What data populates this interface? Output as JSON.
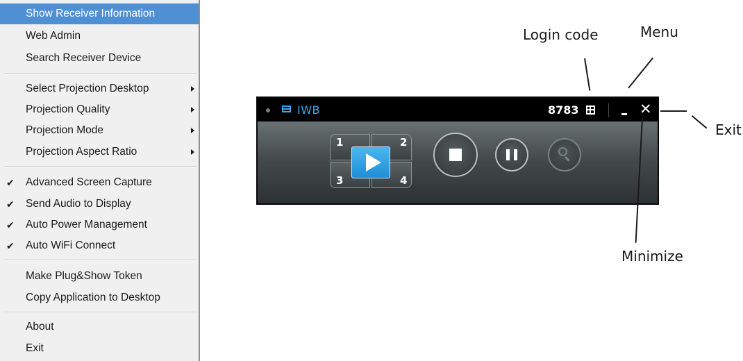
{
  "context_menu": {
    "items": [
      {
        "label": "Show Receiver Information",
        "highlighted": true
      },
      {
        "label": "Web Admin"
      },
      {
        "label": "Search Receiver Device"
      },
      {
        "label": "Select Projection Desktop",
        "submenu": true
      },
      {
        "label": "Projection Quality",
        "submenu": true
      },
      {
        "label": "Projection Mode",
        "submenu": true
      },
      {
        "label": "Projection Aspect Ratio",
        "submenu": true
      },
      {
        "label": "Advanced Screen Capture",
        "checked": true
      },
      {
        "label": "Send Audio to Display",
        "checked": true
      },
      {
        "label": "Auto Power Management",
        "checked": true
      },
      {
        "label": "Auto WiFi Connect",
        "checked": true
      },
      {
        "label": "Make Plug&Show Token"
      },
      {
        "label": "Copy Application to Desktop"
      },
      {
        "label": "About"
      },
      {
        "label": "Exit"
      }
    ],
    "check_glyph": "✔",
    "highlight_color": "#4f8fd4"
  },
  "app": {
    "title": "IWB",
    "login_code": "8783",
    "accent_color": "#3aa6e8",
    "close_glyph": "✕",
    "display_quadrants": [
      "1",
      "2",
      "3",
      "4"
    ],
    "icons": {
      "status": "status-dot-icon",
      "window": "window-icon",
      "menu": "menu-icon",
      "minimize": "minimize-icon",
      "close": "close-icon",
      "play": "play-icon",
      "stop": "stop-icon",
      "pause": "pause-icon",
      "search": "search-icon"
    }
  },
  "callouts": {
    "login_code": "Login code",
    "menu": "Menu",
    "exit": "Exit",
    "minimize": "Minimize"
  }
}
